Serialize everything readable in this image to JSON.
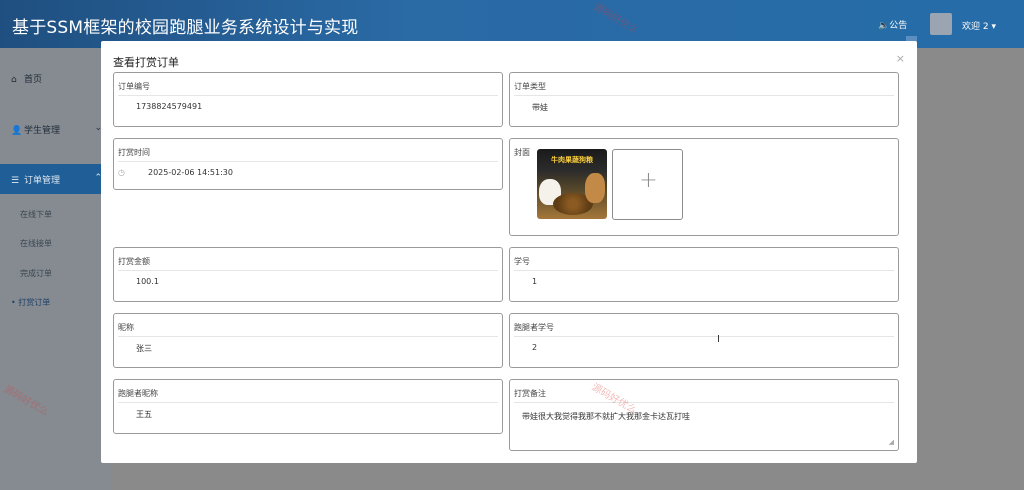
{
  "header": {
    "title": "基于SSM框架的校园跑腿业务系统设计与实现",
    "notice": "🔈公告",
    "welcome": "欢迎 2 ▾"
  },
  "sidebar": {
    "home": "首页",
    "student_mgmt": "学生管理",
    "order_mgmt": "订单管理",
    "sub_items": [
      "在线下单",
      "在线接单",
      "完成订单",
      "打赏订单"
    ],
    "active_bullet": "•"
  },
  "modal": {
    "title": "查看打赏订单",
    "close": "×",
    "fields": {
      "order_no": {
        "label": "订单编号",
        "value": "1738824579491"
      },
      "order_type": {
        "label": "订单类型",
        "value": "带娃"
      },
      "tip_time": {
        "label": "打赏时间",
        "value": "2025-02-06 14:51:30"
      },
      "cover": {
        "label": "封面",
        "image_text": "牛肉果蔬狗粮",
        "upload_plus": "+"
      },
      "tip_amount": {
        "label": "打赏金额",
        "value": "100.1"
      },
      "student_id": {
        "label": "学号",
        "value": "1"
      },
      "nickname": {
        "label": "昵称",
        "value": "张三"
      },
      "runner_id": {
        "label": "跑腿者学号",
        "value": "2"
      },
      "runner_nickname": {
        "label": "跑腿者昵称",
        "value": "王五"
      },
      "tip_note": {
        "label": "打赏备注",
        "value": "带娃很大我觉得我那不就扩大我那金卡达瓦打哇"
      }
    }
  },
  "watermark": "源码好优么",
  "colors": {
    "header": "#256ca8",
    "active": "#1f5e96"
  }
}
